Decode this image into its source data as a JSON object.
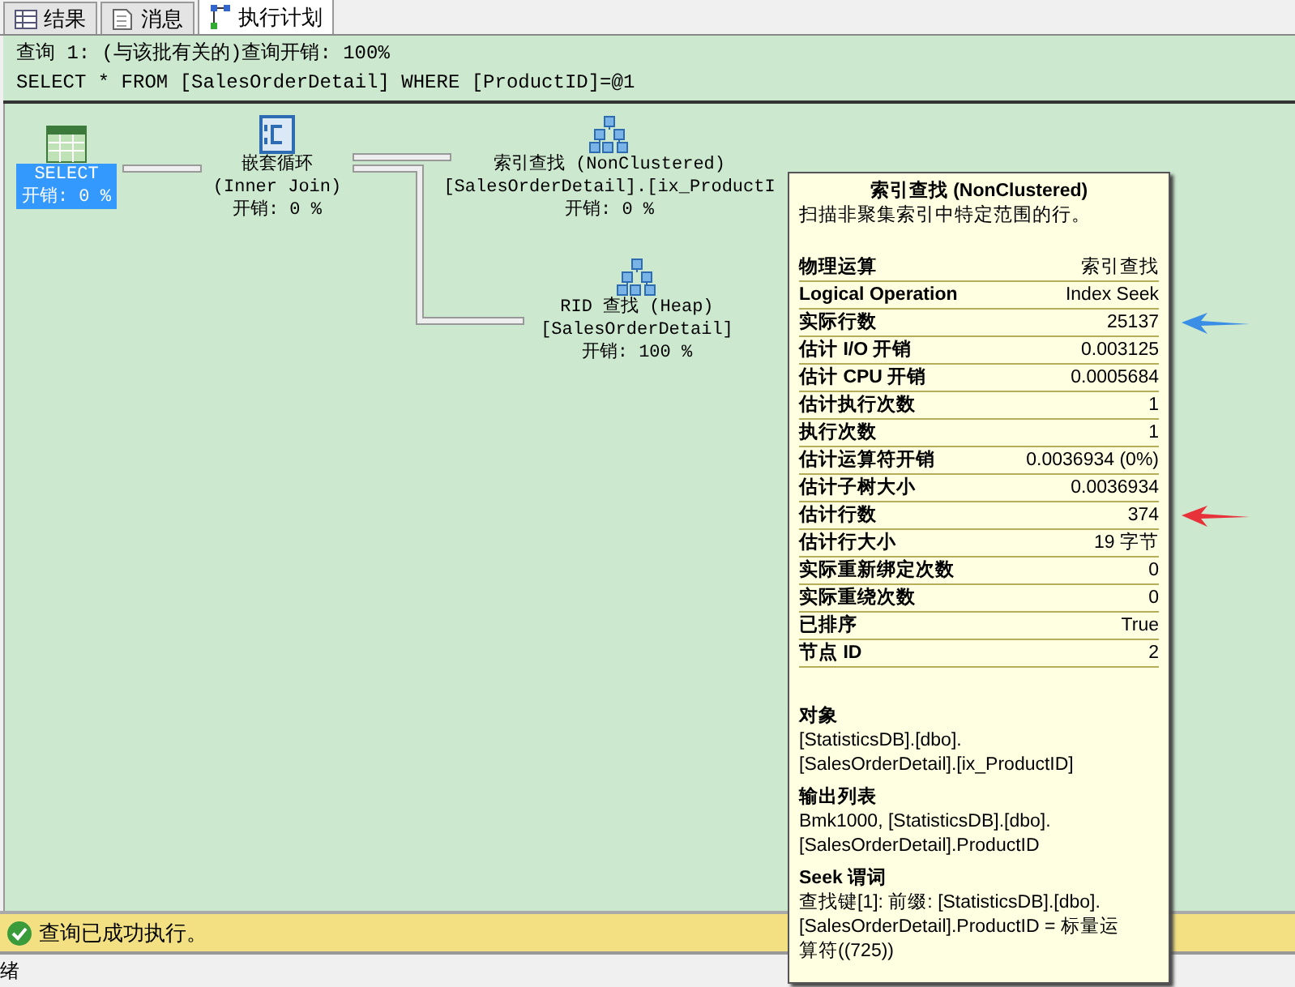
{
  "tabs": [
    {
      "label": "结果",
      "kind": "grid",
      "selected": false
    },
    {
      "label": "消息",
      "kind": "doc",
      "selected": false
    },
    {
      "label": "执行计划",
      "kind": "plan",
      "selected": true
    }
  ],
  "query_header": {
    "title": "查询 1: (与该批有关的)查询开销: 100%",
    "sql": "SELECT * FROM [SalesOrderDetail] WHERE [ProductID]=@1"
  },
  "nodes": [
    {
      "kind": "select",
      "selected": true,
      "lines": [
        "SELECT",
        "开销: 0 %"
      ]
    },
    {
      "kind": "loop",
      "selected": false,
      "lines": [
        "嵌套循环",
        "(Inner Join)",
        "开销: 0 %"
      ]
    },
    {
      "kind": "seek",
      "selected": false,
      "lines": [
        "索引查找 (NonClustered)",
        "[SalesOrderDetail].[ix_ProductI",
        "开销: 0 %"
      ]
    },
    {
      "kind": "lookup",
      "selected": false,
      "lines": [
        "RID 查找 (Heap)",
        "[SalesOrderDetail]",
        "开销: 100 %"
      ]
    }
  ],
  "tooltip": {
    "title": "索引查找 (NonClustered)",
    "description": "扫描非聚集索引中特定范围的行。",
    "properties": [
      {
        "label": "物理运算",
        "value": "索引查找"
      },
      {
        "label": "Logical Operation",
        "value": "Index Seek"
      },
      {
        "label": "实际行数",
        "value": "25137",
        "color": "#3a8ee6"
      },
      {
        "label": "估计 I/O 开销",
        "value": "0.003125"
      },
      {
        "label": "估计 CPU 开销",
        "value": "0.0005684"
      },
      {
        "label": "估计执行次数",
        "value": "1"
      },
      {
        "label": "执行次数",
        "value": "1"
      },
      {
        "label": "估计运算符开销",
        "value": "0.0036934 (0%)"
      },
      {
        "label": "估计子树大小",
        "value": "0.0036934"
      },
      {
        "label": "估计行数",
        "value": "374",
        "color": "#e8323a"
      },
      {
        "label": "估计行大小",
        "value": "19 字节"
      },
      {
        "label": "实际重新绑定次数",
        "value": "0"
      },
      {
        "label": "实际重绕次数",
        "value": "0"
      },
      {
        "label": "已排序",
        "value": "True"
      },
      {
        "label": "节点 ID",
        "value": "2"
      }
    ],
    "sections": [
      {
        "heading": "对象",
        "lines": [
          "[StatisticsDB].[dbo].",
          "[SalesOrderDetail].[ix_ProductID]"
        ]
      },
      {
        "heading": "输出列表",
        "lines": [
          "Bmk1000, [StatisticsDB].[dbo].",
          "[SalesOrderDetail].ProductID"
        ]
      },
      {
        "heading": "Seek 谓词",
        "lines": [
          "查找键[1]: 前缀: [StatisticsDB].[dbo].",
          "[SalesOrderDetail].ProductID = 标量运",
          "算符((725))"
        ]
      }
    ]
  },
  "status": {
    "message": "查询已成功执行。"
  },
  "footer": {
    "text": "绪"
  }
}
